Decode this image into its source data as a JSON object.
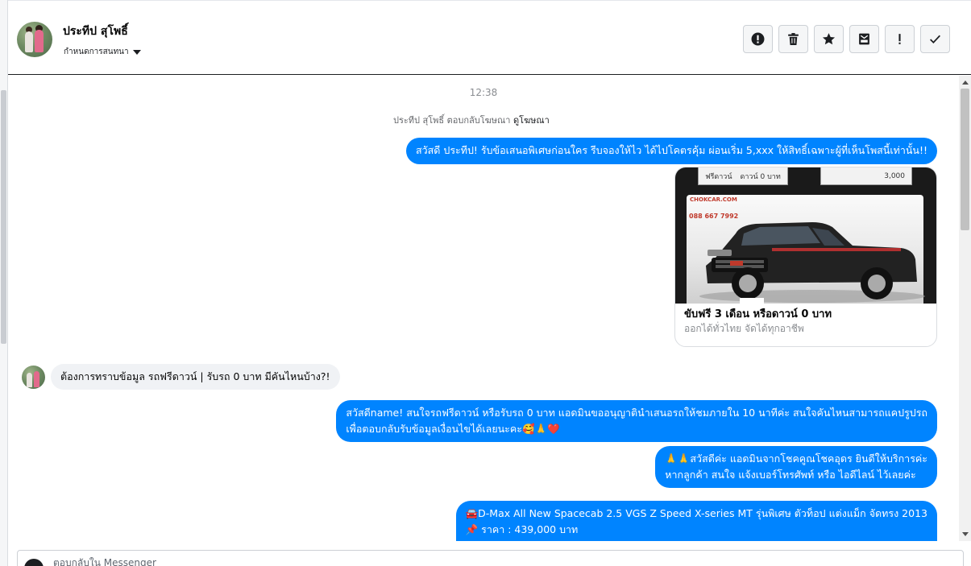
{
  "header": {
    "contact_name": "ประทีป สุโพธิ์",
    "settings_label": "กำหนดการสนทนา"
  },
  "actions": [
    {
      "name": "report-icon"
    },
    {
      "name": "trash-icon"
    },
    {
      "name": "star-icon"
    },
    {
      "name": "archive-icon"
    },
    {
      "name": "exclamation-icon"
    },
    {
      "name": "check-icon"
    }
  ],
  "chat": {
    "timestamp": "12:38",
    "ad_reply_text": "ประทีป สุโพธิ์ ตอบกลับโฆษณา",
    "ad_reply_link": "ดูโฆษณา",
    "messages": [
      {
        "text": "สวัสดี ประทีป! รับข้อเสนอพิเศษก่อนใคร รีบจองให้ไว ได้ไปโคตรคุ้ม ผ่อนเริ่ม 5,xxx  ให้สิทธิ์เฉพาะผู้ที่เห็นโพสนี้เท่านั้น!!"
      },
      {
        "text": "ต้องการทราบข้อมูล รถฟรีดาวน์ | รับรถ 0 บาท มีคันไหนบ้าง?!"
      },
      {
        "line1": "สวัสดีname! สนใจรถฟรีดาวน์ หรือรับรถ 0 บาท แอดมินขออนุญาตินำเสนอรถให้ชมภายใน 10 นาทีค่ะ สนใจคันไหนสามารถแคปรูปรถ",
        "line2": "เพื่อตอบกลับรับข้อมูลเงื่อนไขได้เลยนะคะ🥰🙏❤️"
      },
      {
        "line1": "🙏🙏สวัสดีค่ะ แอดมินจากโชคคูณโชคอุดร ยินดีให้บริการค่ะ",
        "line2": "หากลูกค้า สนใจ แจ้งเบอร์โทรศัพท์ หรือ ไอดีไลน์  ไว้เลยค่ะ"
      },
      {
        "line1": "🚘D-Max All New Spacecab 2.5 VGS Z Speed X-series MT รุ่นพิเศษ ตัวท็อป แต่งแม็ก จัดทรง 2013",
        "line2": "📌 ราคา : 439,000 บาท"
      }
    ],
    "ad_card": {
      "banner_left_a": "ฟรีดาวน์",
      "banner_left_b": "ดาวน์ 0 บาท",
      "banner_right": "3,000",
      "logo_text": "CHOKCAR.COM",
      "phone_text": "088 667 7992",
      "title": "ขับฟรี 3 เดือน หรือดาวน์ 0 บาท",
      "subtitle": "ออกได้ทั่วไทย จัดได้ทุกอาชีพ"
    }
  },
  "composer": {
    "placeholder": "ตอบกลับใน Messenger"
  },
  "colors": {
    "outgoing_bubble": "#0084ff",
    "incoming_bubble": "#f0f2f5",
    "meta_text": "#65676b"
  }
}
